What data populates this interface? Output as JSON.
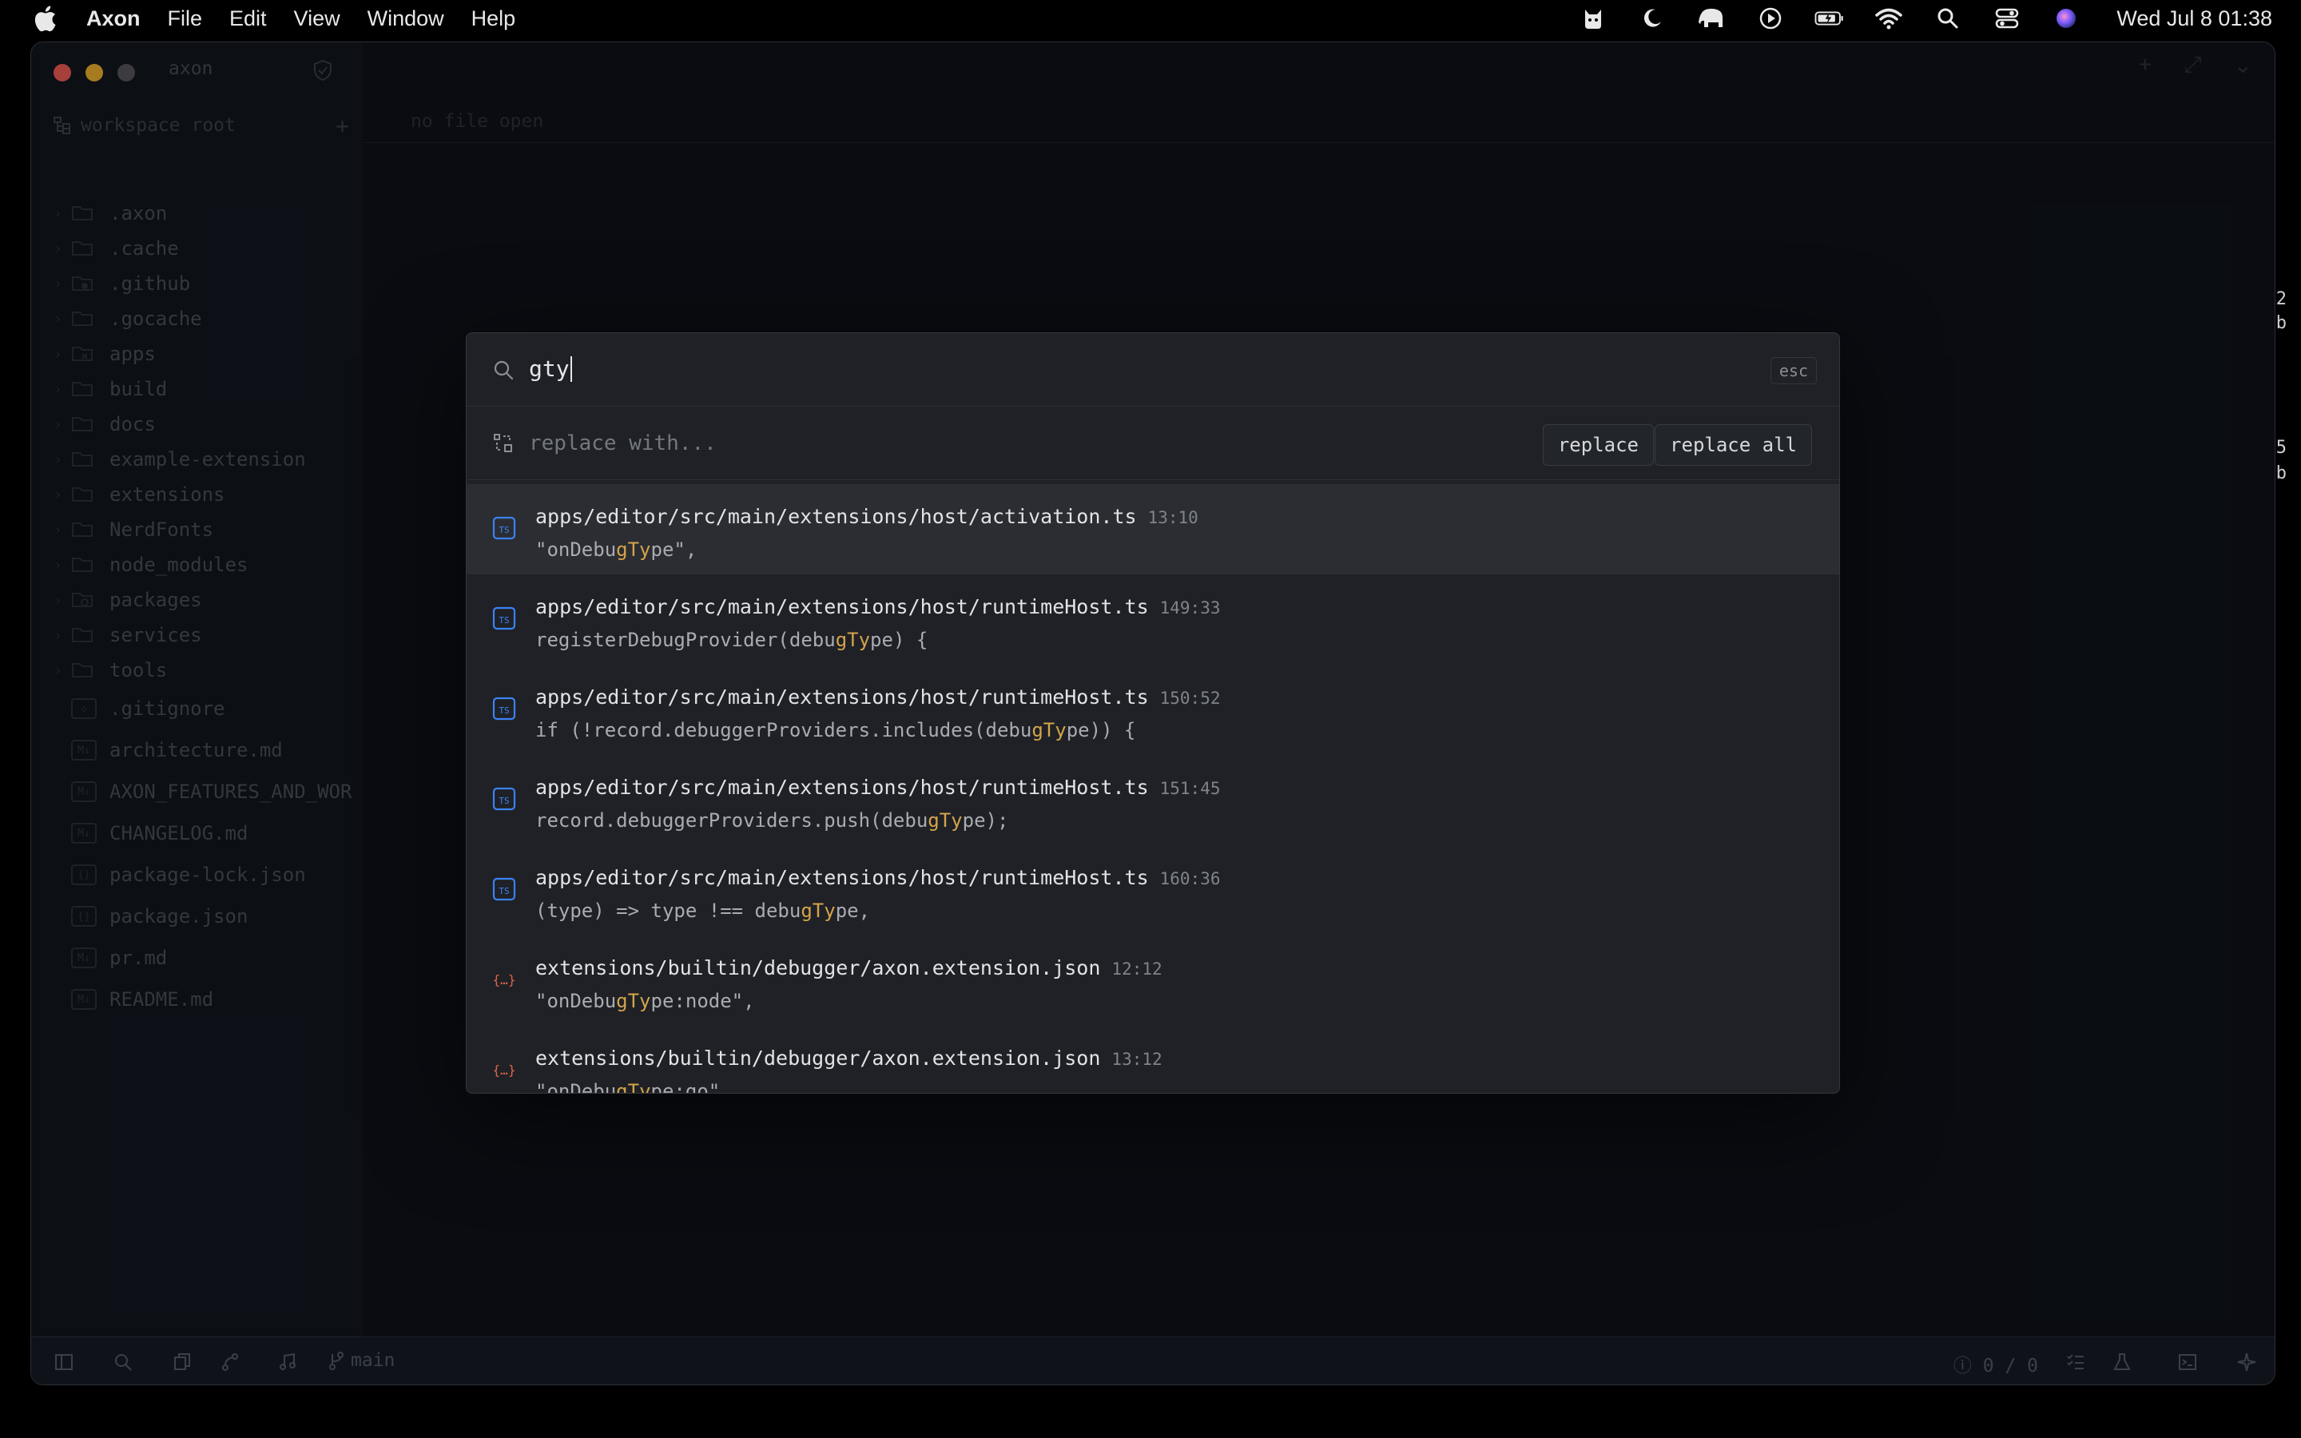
{
  "menubar": {
    "app_name": "Axon",
    "menus": [
      "File",
      "Edit",
      "View",
      "Window",
      "Help"
    ],
    "clock": "Wed Jul 8  01:38"
  },
  "window": {
    "title": "axon",
    "workspace_label": "workspace root",
    "editor_placeholder": "no file open",
    "folders": [
      ".axon",
      ".cache",
      ".github",
      ".gocache",
      "apps",
      "build",
      "docs",
      "example-extension",
      "extensions",
      "NerdFonts",
      "node_modules",
      "packages",
      "services",
      "tools"
    ],
    "files": [
      {
        "name": ".gitignore",
        "badge": "◇"
      },
      {
        "name": "architecture.md",
        "badge": "M↓"
      },
      {
        "name": "AXON_FEATURES_AND_WOR",
        "badge": "M↓"
      },
      {
        "name": "CHANGELOG.md",
        "badge": "M↓"
      },
      {
        "name": "package-lock.json",
        "badge": "{}"
      },
      {
        "name": "package.json",
        "badge": "{}"
      },
      {
        "name": "pr.md",
        "badge": "M↓"
      },
      {
        "name": "README.md",
        "badge": "M↓"
      }
    ],
    "status": {
      "branch": "main",
      "diagnostics": "0 / 0"
    },
    "edge_text": [
      "2",
      "b",
      "5",
      "b"
    ]
  },
  "search": {
    "query": "gty",
    "esc_label": "esc",
    "replace_placeholder": "replace with...",
    "replace_label": "replace",
    "replace_all_label": "replace all",
    "results": [
      {
        "type": "ts",
        "path": "apps/editor/src/main/extensions/host/activation.ts",
        "loc": "13:10",
        "pre": "\"onDebu",
        "match": "gTy",
        "post": "pe\","
      },
      {
        "type": "ts",
        "path": "apps/editor/src/main/extensions/host/runtimeHost.ts",
        "loc": "149:33",
        "pre": "registerDebugProvider(debu",
        "match": "gTy",
        "post": "pe) {"
      },
      {
        "type": "ts",
        "path": "apps/editor/src/main/extensions/host/runtimeHost.ts",
        "loc": "150:52",
        "pre": "if (!record.debuggerProviders.includes(debu",
        "match": "gTy",
        "post": "pe)) {"
      },
      {
        "type": "ts",
        "path": "apps/editor/src/main/extensions/host/runtimeHost.ts",
        "loc": "151:45",
        "pre": "record.debuggerProviders.push(debu",
        "match": "gTy",
        "post": "pe);"
      },
      {
        "type": "ts",
        "path": "apps/editor/src/main/extensions/host/runtimeHost.ts",
        "loc": "160:36",
        "pre": "(type) => type !== debu",
        "match": "gTy",
        "post": "pe,"
      },
      {
        "type": "json",
        "path": "extensions/builtin/debugger/axon.extension.json",
        "loc": "12:12",
        "pre": "\"onDebu",
        "match": "gTy",
        "post": "pe:node\","
      },
      {
        "type": "json",
        "path": "extensions/builtin/debugger/axon.extension.json",
        "loc": "13:12",
        "pre": "\"onDebu",
        "match": "gTy",
        "post": "pe:go\","
      }
    ]
  },
  "colors": {
    "accent_ts": "#3b82f6",
    "accent_json": "#e0654a",
    "match_highlight": "#d4a44a"
  }
}
